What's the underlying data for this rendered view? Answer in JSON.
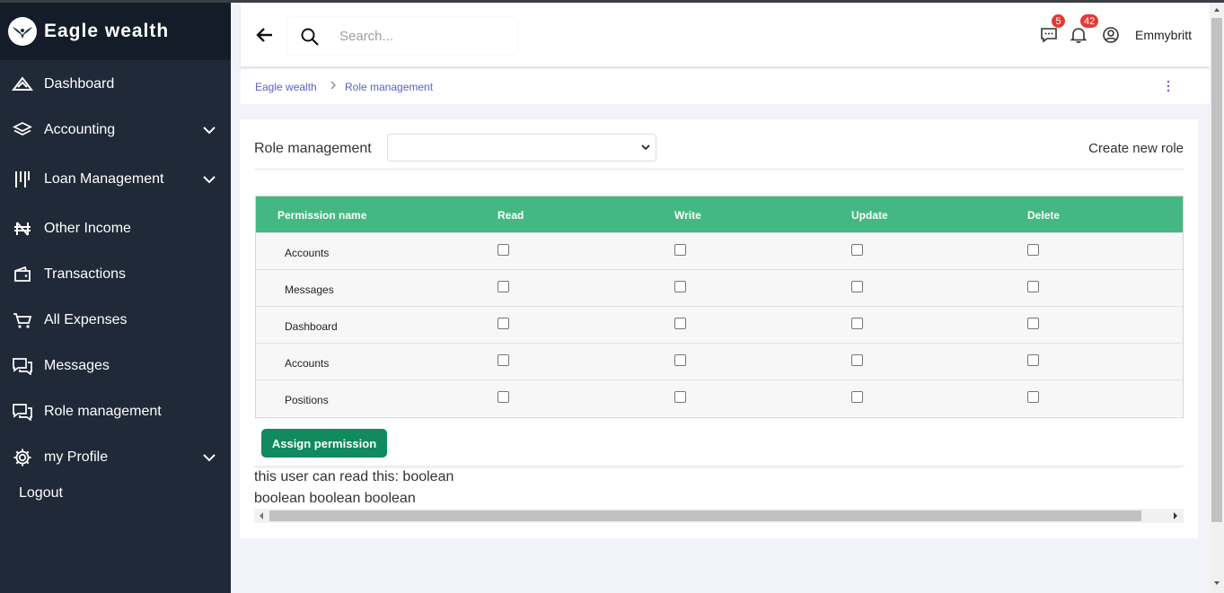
{
  "app": {
    "name": "Eagle wealth"
  },
  "sidebar": {
    "items": [
      {
        "label": "Dashboard",
        "icon": "dashboard-icon",
        "has_submenu": false
      },
      {
        "label": "Accounting",
        "icon": "layers-icon",
        "has_submenu": true
      },
      {
        "label": "Loan Management",
        "icon": "bars-icon",
        "has_submenu": true
      },
      {
        "label": "Other Income",
        "icon": "naira-icon",
        "has_submenu": false
      },
      {
        "label": "Transactions",
        "icon": "wallet-icon",
        "has_submenu": false
      },
      {
        "label": "All Expenses",
        "icon": "cart-icon",
        "has_submenu": false
      },
      {
        "label": "Messages",
        "icon": "chat-icon",
        "has_submenu": false
      },
      {
        "label": "Role management",
        "icon": "chat-icon",
        "has_submenu": false
      },
      {
        "label": "my Profile",
        "icon": "gear-icon",
        "has_submenu": true
      }
    ],
    "logout_label": "Logout"
  },
  "header": {
    "search_placeholder": "Search...",
    "messages_badge": "5",
    "notifications_badge": "42",
    "username": "Emmybritt"
  },
  "breadcrumb": {
    "root": "Eagle wealth",
    "current": "Role management"
  },
  "role_panel": {
    "title": "Role management",
    "selected_role": "",
    "create_label": "Create new role"
  },
  "permissions_table": {
    "columns": [
      "Permission name",
      "Read",
      "Write",
      "Update",
      "Delete"
    ],
    "rows": [
      {
        "name": "Accounts",
        "read": false,
        "write": false,
        "update": false,
        "delete": false
      },
      {
        "name": "Messages",
        "read": false,
        "write": false,
        "update": false,
        "delete": false
      },
      {
        "name": "Dashboard",
        "read": false,
        "write": false,
        "update": false,
        "delete": false
      },
      {
        "name": "Accounts",
        "read": false,
        "write": false,
        "update": false,
        "delete": false
      },
      {
        "name": "Positions",
        "read": false,
        "write": false,
        "update": false,
        "delete": false
      }
    ]
  },
  "assign_button_label": "Assign permission",
  "info_lines": [
    "this user can read this: boolean",
    "boolean boolean boolean"
  ],
  "colors": {
    "sidebar_bg": "#1f2937",
    "brand_bg": "#141c2a",
    "table_header": "#44b882",
    "primary_button": "#108a5e",
    "link": "#5b5fc7",
    "badge": "#e53935"
  }
}
